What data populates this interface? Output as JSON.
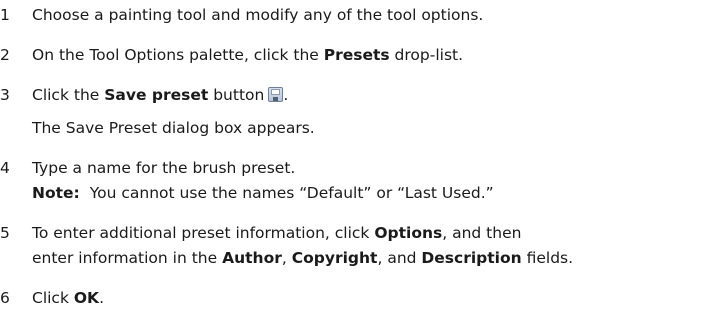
{
  "steps": [
    {
      "number": "1",
      "text": "Choose a painting tool and modify any of the tool options."
    },
    {
      "number": "2",
      "pre": "On the Tool Options palette, click the ",
      "bold": "Presets",
      "post": " drop-list."
    },
    {
      "number": "3",
      "pre": "Click the ",
      "bold": "Save preset",
      "post": " button",
      "end": ".",
      "icon": "save-icon",
      "sub": "The Save Preset dialog box appears."
    },
    {
      "number": "4",
      "text": "Type a name for the brush preset.",
      "note_label": "Note:",
      "note_text": "You cannot use the names “Default” or “Last Used.”"
    },
    {
      "number": "5",
      "line1_pre": "To enter additional preset information, click ",
      "line1_bold": "Options",
      "line1_post": ", and then",
      "line2_pre": "enter information in the ",
      "b1": "Author",
      "sep1": ", ",
      "b2": "Copyright",
      "sep2": ", and ",
      "b3": "Description",
      "line2_post": " fields."
    },
    {
      "number": "6",
      "pre": "Click ",
      "bold": "OK",
      "post": "."
    }
  ]
}
